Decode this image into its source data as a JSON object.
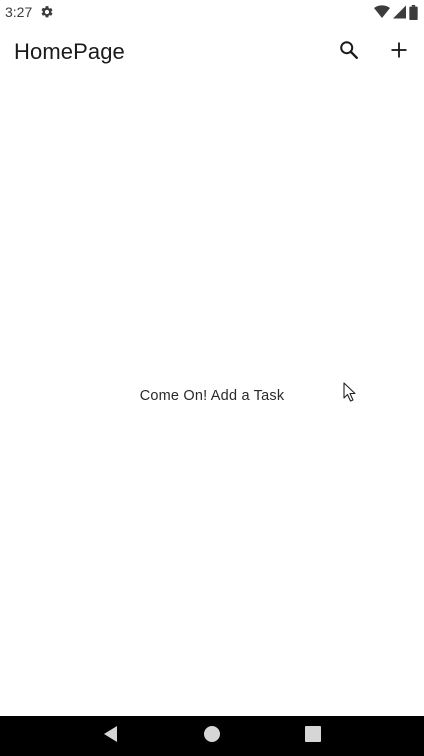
{
  "status_bar": {
    "time": "3:27",
    "icons": [
      "settings-icon",
      "wifi-icon",
      "signal-icon",
      "battery-icon"
    ]
  },
  "app_bar": {
    "title": "HomePage",
    "actions": [
      "search-icon",
      "add-icon"
    ]
  },
  "main": {
    "empty_message": "Come On! Add a Task"
  },
  "nav_bar": {
    "buttons": [
      "back-icon",
      "home-icon",
      "recents-icon"
    ]
  },
  "colors": {
    "background": "#ffffff",
    "text": "#1a1a1a",
    "nav_bar": "#000000"
  }
}
